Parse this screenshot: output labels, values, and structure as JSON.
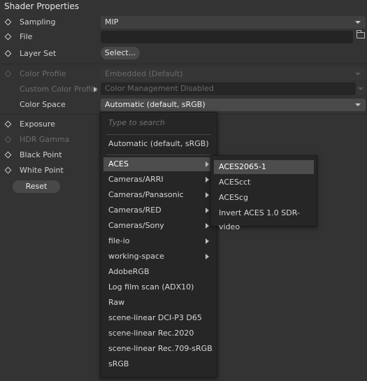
{
  "panel": {
    "title": "Shader Properties",
    "sampling": {
      "label": "Sampling",
      "value": "MIP"
    },
    "file": {
      "label": "File",
      "value": ""
    },
    "layer_set": {
      "label": "Layer Set",
      "button": "Select..."
    },
    "color_profile": {
      "label": "Color Profile",
      "value": "Embedded (Default)"
    },
    "custom_color_profile": {
      "label": "Custom Color Profile",
      "value": "Color Management Disabled"
    },
    "color_space": {
      "label": "Color Space",
      "value": "Automatic (default, sRGB)"
    },
    "exposure": {
      "label": "Exposure"
    },
    "hdr_gamma": {
      "label": "HDR Gamma"
    },
    "black_point": {
      "label": "Black Point"
    },
    "white_point": {
      "label": "White Point"
    },
    "reset_button": "Reset"
  },
  "menu": {
    "search_placeholder": "Type to search",
    "top_item": "Automatic (default, sRGB)",
    "items": [
      {
        "label": "ACES",
        "submenu": true,
        "highlighted": true
      },
      {
        "label": "Cameras/ARRI",
        "submenu": true
      },
      {
        "label": "Cameras/Panasonic",
        "submenu": true
      },
      {
        "label": "Cameras/RED",
        "submenu": true
      },
      {
        "label": "Cameras/Sony",
        "submenu": true
      },
      {
        "label": "file-io",
        "submenu": true
      },
      {
        "label": "working-space",
        "submenu": true
      },
      {
        "label": "AdobeRGB",
        "submenu": false
      },
      {
        "label": "Log film scan (ADX10)",
        "submenu": false
      },
      {
        "label": "Raw",
        "submenu": false
      },
      {
        "label": "scene-linear DCI-P3 D65",
        "submenu": false
      },
      {
        "label": "scene-linear Rec.2020",
        "submenu": false
      },
      {
        "label": "scene-linear Rec.709-sRGB",
        "submenu": false
      },
      {
        "label": "sRGB",
        "submenu": false
      }
    ]
  },
  "submenu": {
    "items": [
      {
        "label": "ACES2065-1",
        "highlighted": true
      },
      {
        "label": "ACEScct"
      },
      {
        "label": "ACEScg"
      },
      {
        "label": "Invert ACES 1.0 SDR-video"
      }
    ]
  }
}
